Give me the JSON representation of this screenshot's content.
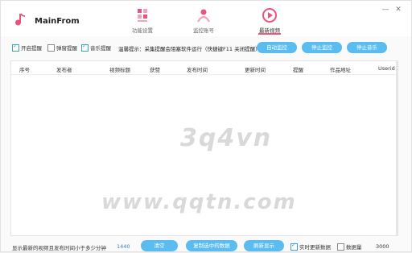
{
  "app": {
    "name": "MainFrom"
  },
  "tabs": [
    {
      "label": "功能设置",
      "icon": "settings-grid-icon",
      "active": false
    },
    {
      "label": "监控账号",
      "icon": "user-monitor-icon",
      "active": false
    },
    {
      "label": "最新视频",
      "icon": "video-play-icon",
      "active": true
    }
  ],
  "window": {
    "minimize": "—",
    "close": "✕"
  },
  "toolbar": {
    "checkboxes": [
      {
        "label": "开启提醒",
        "checked": true
      },
      {
        "label": "弹窗提醒",
        "checked": false
      },
      {
        "label": "音乐提醒",
        "checked": true
      }
    ],
    "notice": "温馨提示：采集提醒会阻塞软件运行（快捷键F11 关闭提醒）",
    "buttons": {
      "auto_monitor": "自动监控",
      "stop_monitor": "停止监控",
      "stop_music": "停止音乐"
    }
  },
  "table": {
    "columns": [
      "序号",
      "发布者",
      "视频标题",
      "获赞",
      "发布时间",
      "更新时间",
      "提醒",
      "作品地址",
      "Userid"
    ],
    "rows": []
  },
  "footer": {
    "threshold_label": "显示最新的视频且发布时间小于多少分钟",
    "threshold_value": "1440",
    "clear_button": "清空",
    "copy_button": "复制选中的数据",
    "refresh_button": "刷新显示",
    "realtime_checkbox": {
      "label": "实时更新数据",
      "checked": true
    },
    "count_checkbox": {
      "label": "数据量",
      "checked": false
    },
    "count_value": "3000"
  },
  "watermark": {
    "line1": "3q4vn",
    "line2": "www.qqtn.com"
  },
  "colors": {
    "accent": "#5bbcf0",
    "brand": "#e8547e",
    "check": "#3aa0d8"
  }
}
